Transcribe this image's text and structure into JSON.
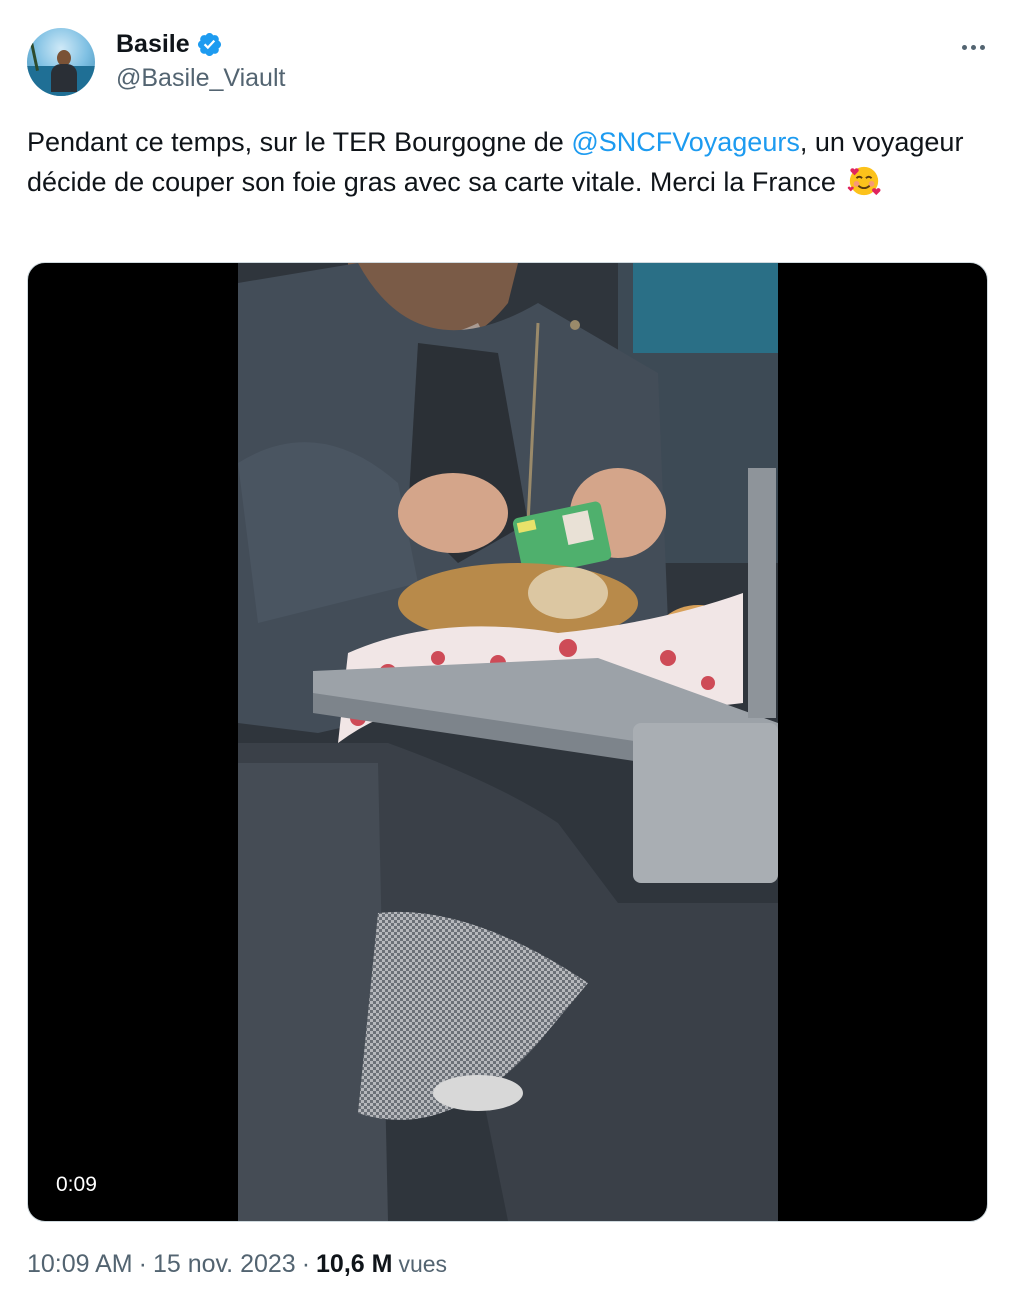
{
  "author": {
    "display_name": "Basile",
    "handle": "@Basile_Viault",
    "verified": true
  },
  "icons": {
    "verified": "verified-badge-icon",
    "more": "more-options-icon",
    "emoji": "smiling-face-with-hearts-emoji"
  },
  "tweet": {
    "text_part1": "Pendant ce temps, sur le TER Bourgogne de ",
    "mention": "@SNCFVoyageurs",
    "text_part2": ", un voyageur décide de couper son foie gras avec sa carte vitale. Merci la France ",
    "emoji": "🥰"
  },
  "media": {
    "type": "video",
    "duration": "0:09"
  },
  "footer": {
    "time": "10:09 AM",
    "separator": "·",
    "date": "15 nov. 2023",
    "views_count": "10,6 M",
    "views_label": "vues"
  },
  "colors": {
    "accent": "#1d9bf0",
    "text_primary": "#0f1419",
    "text_secondary": "#536471",
    "border": "#cfd9de"
  }
}
